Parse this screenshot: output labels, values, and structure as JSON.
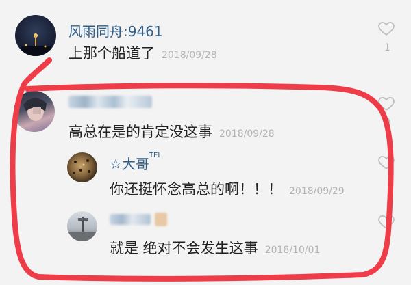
{
  "comments": [
    {
      "username": "风雨同舟:9461",
      "text": "上那个船道了",
      "time": "2018/09/28",
      "likes": "1"
    },
    {
      "username": "",
      "text": "高总在是的肯定没这事",
      "time": "2018/09/28",
      "likes": "9"
    }
  ],
  "replies": [
    {
      "username": "☆大哥",
      "badge": "TEL",
      "text": "你还挺怀念高总的啊！！！",
      "time": "2018/09/29"
    },
    {
      "username": "",
      "text": "就是  绝对不会发生这事",
      "time": "2018/10/01"
    }
  ],
  "colors": {
    "background": "#f3f3f3",
    "username": "#2f5f8a",
    "timestamp": "#b4b4b4",
    "highlight": "#ee3c48"
  },
  "icons": {
    "like": "heart-outline-icon"
  }
}
